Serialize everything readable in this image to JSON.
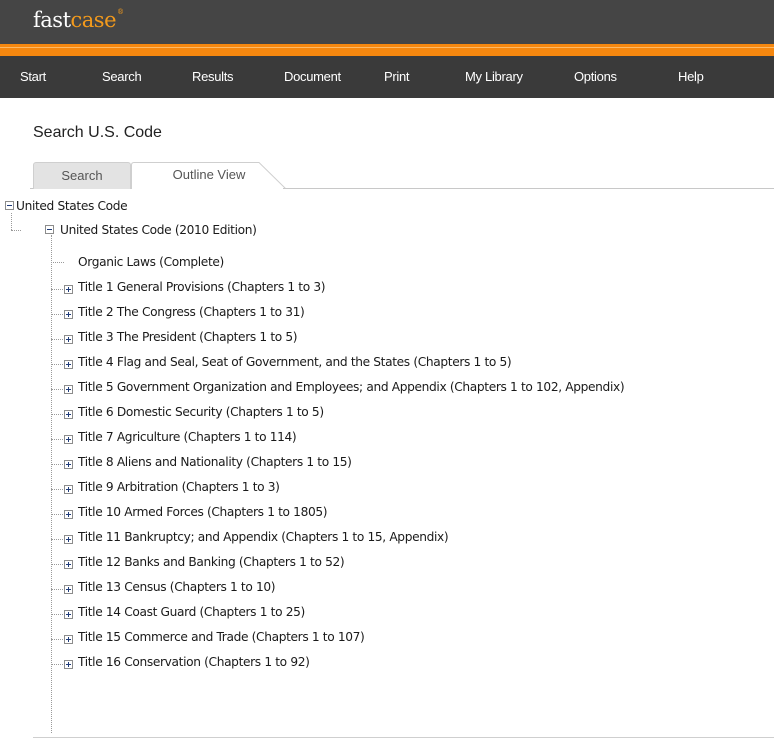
{
  "app": {
    "logo_prefix": "fast",
    "logo_suffix": "case",
    "logo_mark": "®"
  },
  "nav": {
    "items": [
      "Start",
      "Search",
      "Results",
      "Document",
      "Print",
      "My Library",
      "Options",
      "Help"
    ]
  },
  "page": {
    "title": "Search U.S. Code"
  },
  "tabs": [
    {
      "label": "Search",
      "active": false
    },
    {
      "label": "Outline View",
      "active": true
    }
  ],
  "tree": {
    "root": {
      "label": "United States Code",
      "expanded": true
    },
    "edition": {
      "label": "United States Code (2010 Edition)",
      "expanded": true
    },
    "children": [
      {
        "label": "Organic Laws (Complete)",
        "expandable": false
      },
      {
        "label": "Title 1 General Provisions (Chapters 1 to 3)",
        "expandable": true
      },
      {
        "label": "Title 2 The Congress (Chapters 1 to 31)",
        "expandable": true
      },
      {
        "label": "Title 3 The President (Chapters 1 to 5)",
        "expandable": true
      },
      {
        "label": "Title 4 Flag and Seal, Seat of Government, and the States (Chapters 1 to 5)",
        "expandable": true
      },
      {
        "label": "Title 5 Government Organization and Employees; and Appendix (Chapters 1 to 102, Appendix)",
        "expandable": true
      },
      {
        "label": "Title 6 Domestic Security (Chapters 1 to 5)",
        "expandable": true
      },
      {
        "label": "Title 7 Agriculture (Chapters 1 to 114)",
        "expandable": true
      },
      {
        "label": "Title 8 Aliens and Nationality (Chapters 1 to 15)",
        "expandable": true
      },
      {
        "label": "Title 9 Arbitration (Chapters 1 to 3)",
        "expandable": true
      },
      {
        "label": "Title 10 Armed Forces (Chapters 1 to 1805)",
        "expandable": true
      },
      {
        "label": "Title 11 Bankruptcy; and Appendix (Chapters 1 to 15, Appendix)",
        "expandable": true
      },
      {
        "label": "Title 12 Banks and Banking (Chapters 1 to 52)",
        "expandable": true
      },
      {
        "label": "Title 13 Census (Chapters 1 to 10)",
        "expandable": true
      },
      {
        "label": "Title 14 Coast Guard (Chapters 1 to 25)",
        "expandable": true
      },
      {
        "label": "Title 15 Commerce and Trade (Chapters 1 to 107)",
        "expandable": true
      },
      {
        "label": "Title 16 Conservation (Chapters 1 to 92)",
        "expandable": true
      }
    ]
  },
  "colors": {
    "topbar": "#454545",
    "navbar": "#3a3a3a",
    "accent": "#f5870f",
    "logo_accent": "#f39a1c",
    "tree_connector": "#9a9a9a",
    "toggle_glyph": "#1f3b7a"
  },
  "icons": {
    "expanded": "minus-box-icon",
    "collapsed": "plus-box-icon"
  }
}
